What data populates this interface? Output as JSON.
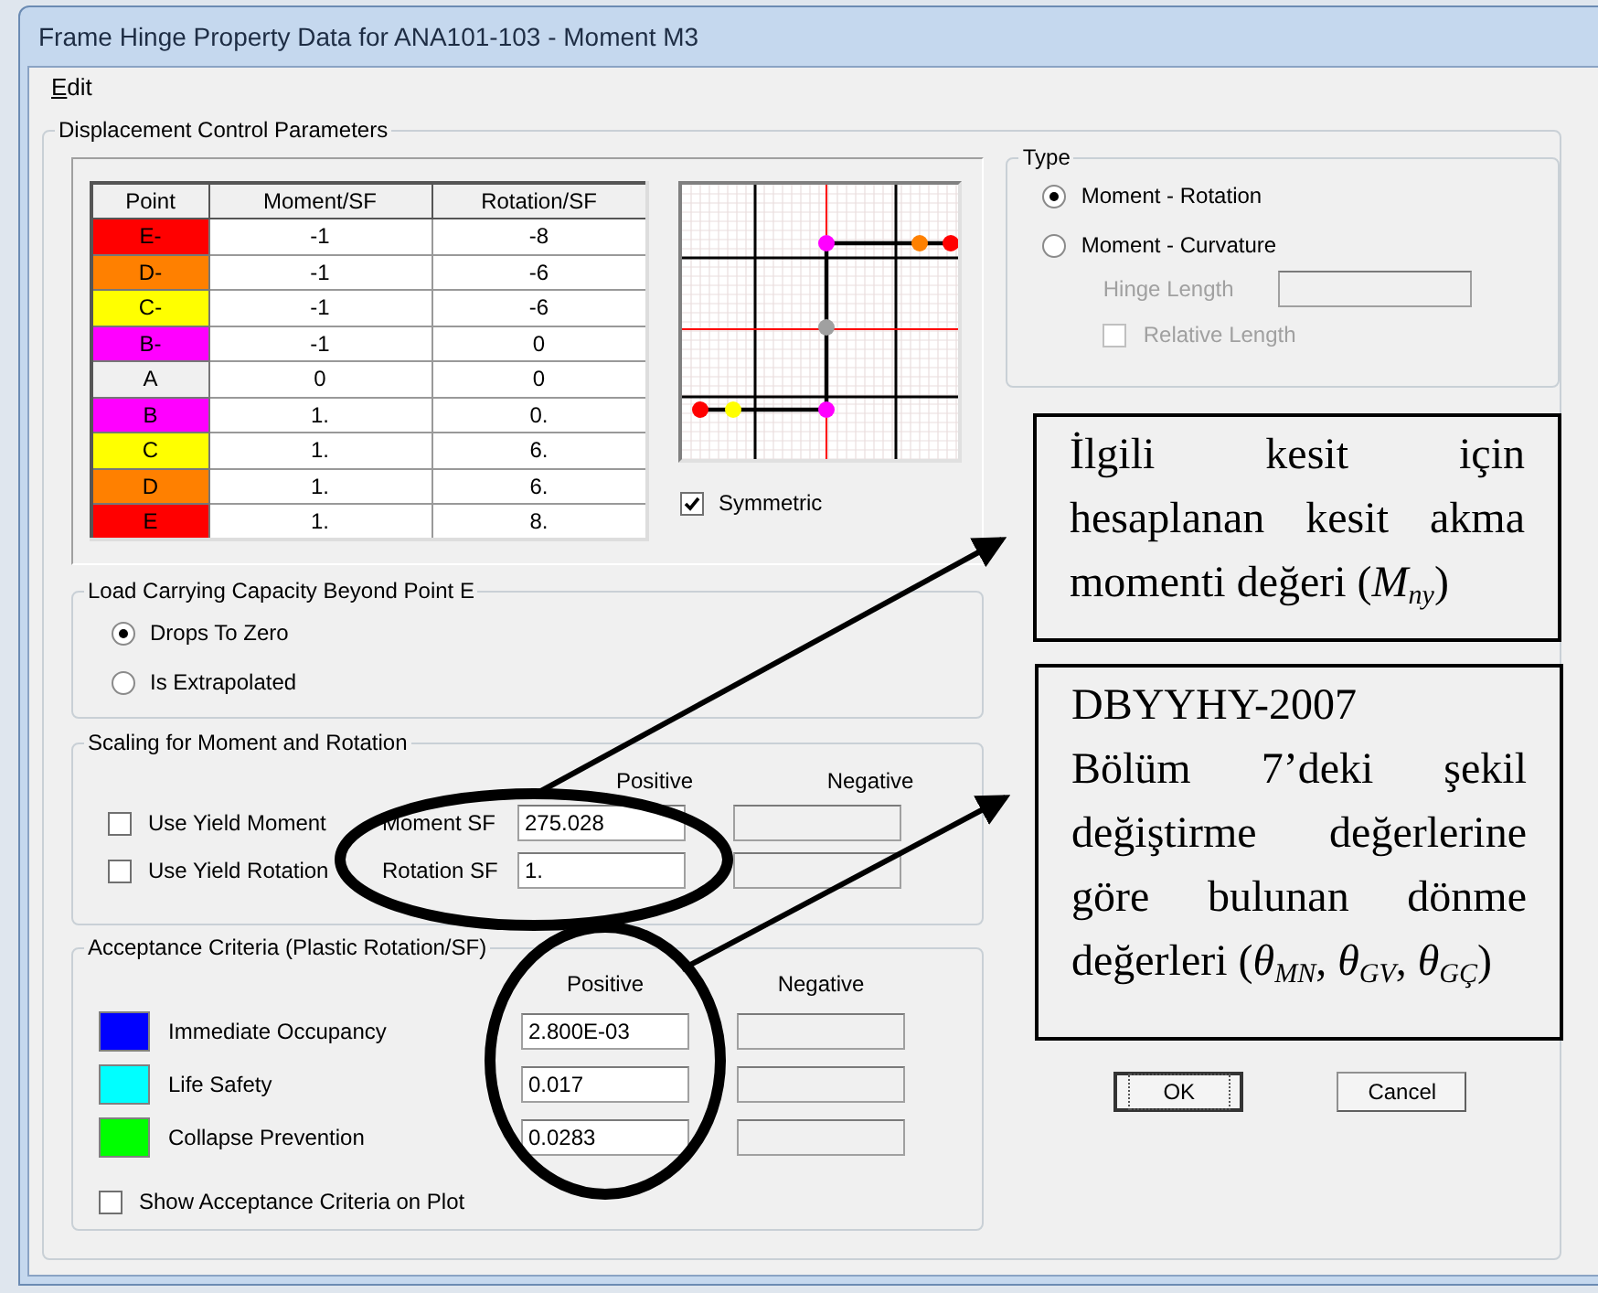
{
  "window": {
    "title": "Frame Hinge Property Data for ANA101-103 - Moment M3"
  },
  "menu": [
    {
      "label": "Edit"
    }
  ],
  "displacement": {
    "title": "Displacement Control Parameters",
    "columns": [
      "Point",
      "Moment/SF",
      "Rotation/SF"
    ],
    "rows": [
      {
        "point": "E-",
        "color": "#ff0000",
        "moment": "-1",
        "rotation": "-8"
      },
      {
        "point": "D-",
        "color": "#ff8000",
        "moment": "-1",
        "rotation": "-6"
      },
      {
        "point": "C-",
        "color": "#ffff00",
        "moment": "-1",
        "rotation": "-6"
      },
      {
        "point": "B-",
        "color": "#ff00ff",
        "moment": "-1",
        "rotation": "0"
      },
      {
        "point": "A",
        "color": "#f0f0f0",
        "moment": "0",
        "rotation": "0"
      },
      {
        "point": "B",
        "color": "#ff00ff",
        "moment": "1.",
        "rotation": "0."
      },
      {
        "point": "C",
        "color": "#ffff00",
        "moment": "1.",
        "rotation": "6."
      },
      {
        "point": "D",
        "color": "#ff8000",
        "moment": "1.",
        "rotation": "6."
      },
      {
        "point": "E",
        "color": "#ff0000",
        "moment": "1.",
        "rotation": "8."
      }
    ],
    "symmetric": {
      "label": "Symmetric",
      "checked": true
    }
  },
  "type": {
    "title": "Type",
    "options": [
      {
        "label": "Moment - Rotation",
        "selected": true
      },
      {
        "label": "Moment - Curvature",
        "selected": false
      }
    ],
    "hinge_length": {
      "label": "Hinge Length",
      "disabled": true
    },
    "relative_length": {
      "label": "Relative Length",
      "checked": false,
      "disabled": true
    }
  },
  "load_capacity": {
    "title": "Load Carrying Capacity Beyond Point E",
    "options": [
      {
        "label": "Drops To Zero",
        "selected": true
      },
      {
        "label": "Is Extrapolated",
        "selected": false
      }
    ]
  },
  "scaling": {
    "title": "Scaling for Moment and Rotation",
    "positive_header": "Positive",
    "negative_header": "Negative",
    "rows": [
      {
        "checkbox": "Use Yield Moment",
        "checked": false,
        "label": "Moment SF",
        "positive": "275.028"
      },
      {
        "checkbox": "Use Yield Rotation",
        "checked": false,
        "label": "Rotation SF",
        "positive": "1."
      }
    ]
  },
  "acceptance": {
    "title": "Acceptance Criteria (Plastic Rotation/SF)",
    "positive_header": "Positive",
    "negative_header": "Negative",
    "rows": [
      {
        "label": "Immediate Occupancy",
        "color": "#0000ff",
        "positive": "2.800E-03"
      },
      {
        "label": "Life Safety",
        "color": "#00ffff",
        "positive": "0.017"
      },
      {
        "label": "Collapse Prevention",
        "color": "#00ff00",
        "positive": "0.0283"
      }
    ],
    "show_on_plot": {
      "label": "Show Acceptance Criteria on Plot",
      "checked": false
    }
  },
  "buttons": [
    {
      "label": "OK",
      "focused": true
    },
    {
      "label": "Cancel",
      "focused": false
    }
  ],
  "annotations": [
    {
      "lines": [
        "İlgili kesit için hesaplanan kesit akma momenti değeri (*M*$_{ny}$)"
      ]
    },
    {
      "lines": [
        "DBYYHY-2007",
        "Bölüm 7’deki şekil değiştirme değerlerine göre bulunan dönme değerleri (*θ*$_{MN}$, *θ*$_{GV}$, *θ*$_{GÇ}$)"
      ]
    }
  ]
}
